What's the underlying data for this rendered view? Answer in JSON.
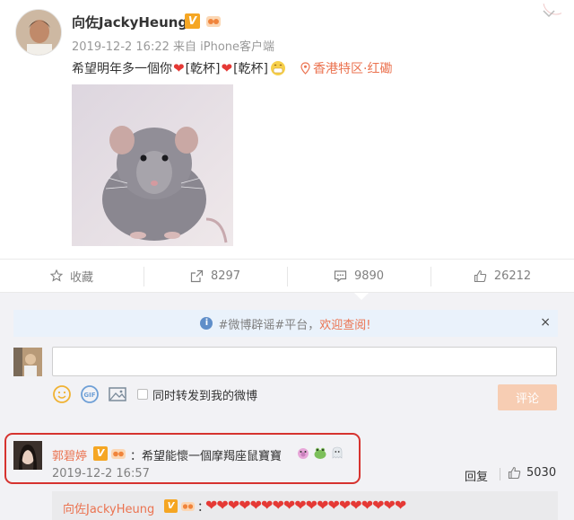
{
  "post": {
    "author": "向佐JackyHeung",
    "verified_badge": "V",
    "meta": "2019-12-2 16:22  来自 iPhone客户端",
    "text_parts": [
      "希望明年多一個你",
      "[乾杯]",
      "[乾杯]"
    ],
    "location": "香港特区·红磡"
  },
  "actions": {
    "favorite": "收藏",
    "repost_count": "8297",
    "comment_count": "9890",
    "like_count": "26212"
  },
  "comment_box": {
    "notice_prefix": "#微博辟谣#平台，",
    "notice_link": "欢迎查阅!",
    "notice_close": "×",
    "input_placeholder": "",
    "repost_label": "同时转发到我的微博",
    "submit_label": "评论"
  },
  "top_comment": {
    "author": "郭碧婷",
    "verified_badge": "V",
    "text": "：希望能懷一個摩羯座鼠寶寶",
    "time": "2019-12-2 16:57",
    "reply_label": "回复",
    "like_count": "5030"
  },
  "sub_reply": {
    "author": "向佐JackyHeung",
    "verified_badge": "V",
    "colon": "：",
    "hearts": "❤❤❤❤❤❤❤❤❤❤❤❤❤❤❤❤❤❤"
  },
  "colors": {
    "accent_orange": "#eb7350",
    "heart_red": "#e53935",
    "verified_gold": "#f5a623",
    "highlight_red": "#d6332f"
  },
  "icons": [
    "chevron-down-icon",
    "location-pin-icon",
    "star-icon",
    "repost-icon",
    "comment-icon",
    "thumb-up-icon",
    "info-icon",
    "emoji-icon",
    "gif-icon",
    "image-icon"
  ]
}
